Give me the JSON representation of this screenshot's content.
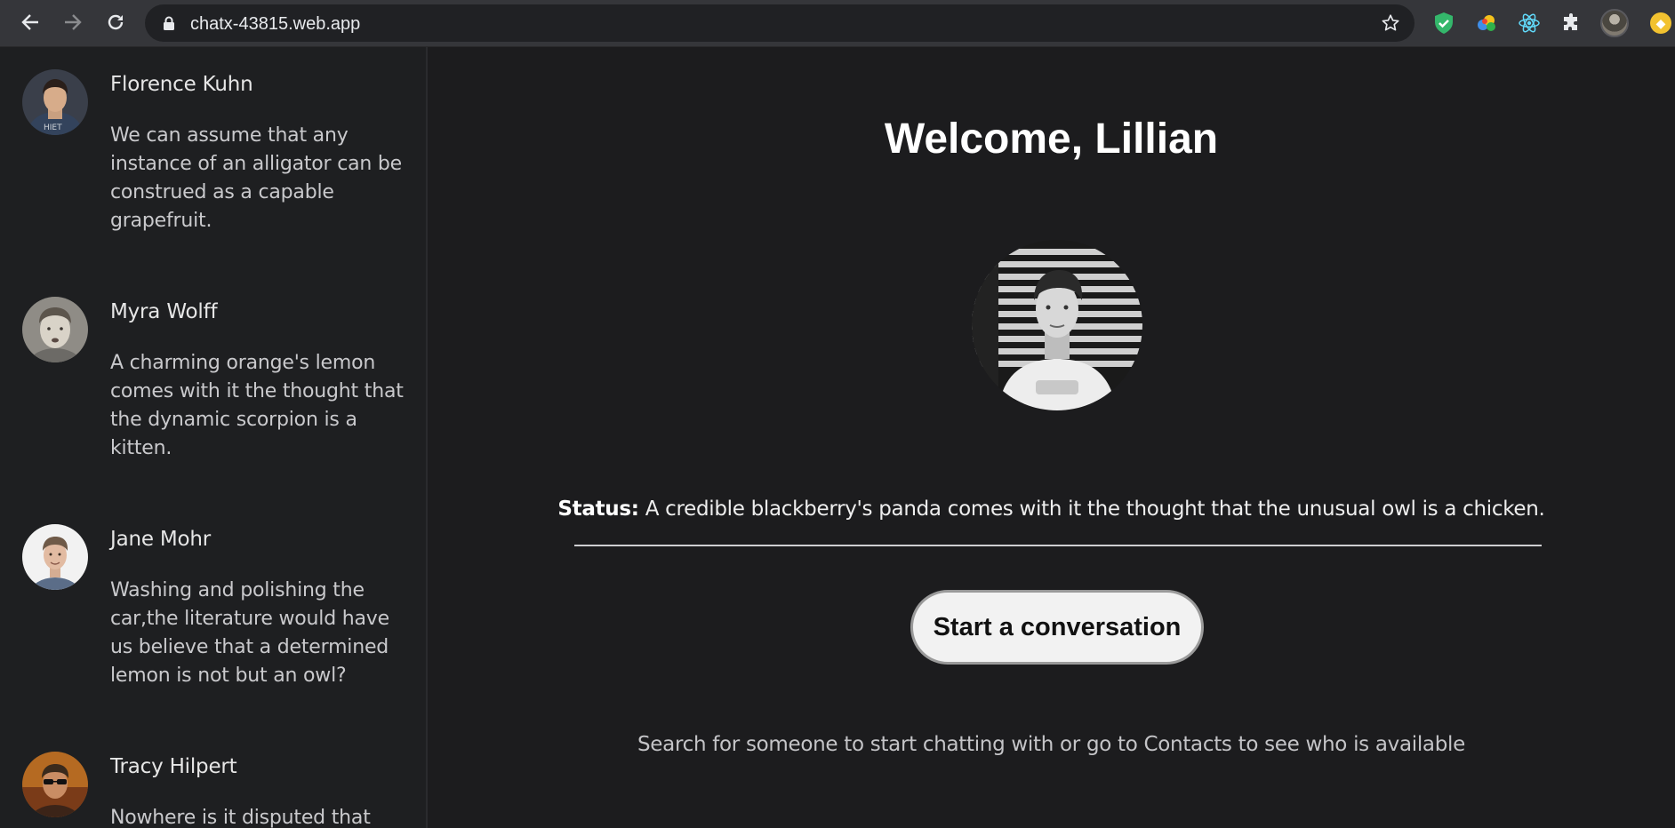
{
  "browser": {
    "url": "chatx-43815.web.app",
    "icons": [
      "back-arrow-icon",
      "forward-arrow-icon",
      "reload-icon",
      "lock-icon",
      "bookmark-star-icon",
      "shield-extension-icon",
      "colorful-extension-icon",
      "react-devtools-icon",
      "puzzle-extensions-icon",
      "profile-avatar",
      "coin-extension-icon"
    ]
  },
  "sidebar": {
    "contacts": [
      {
        "name": "Florence Kuhn",
        "message": "We can assume that any instance of an alligator can be construed as a capable grapefruit."
      },
      {
        "name": "Myra Wolff",
        "message": "A charming orange's lemon comes with it the thought that the dynamic scorpion is a kitten."
      },
      {
        "name": "Jane Mohr",
        "message": "Washing and polishing the car,the literature would have us believe that a determined lemon is not but an owl?"
      },
      {
        "name": "Tracy Hilpert",
        "message": "Nowhere is it disputed that"
      }
    ]
  },
  "main": {
    "welcome": "Welcome, Lillian",
    "status_label": "Status:",
    "status_text": "A credible blackberry's panda comes with it the thought that the unusual owl is a chicken.",
    "start_button": "Start a conversation",
    "hint": "Search for someone to start chatting with or go to Contacts to see who is available"
  },
  "colors": {
    "background": "#1c1c1e",
    "sidebar": "#1e1f21",
    "chrome": "#35363a",
    "button": "#f2f2f2"
  }
}
